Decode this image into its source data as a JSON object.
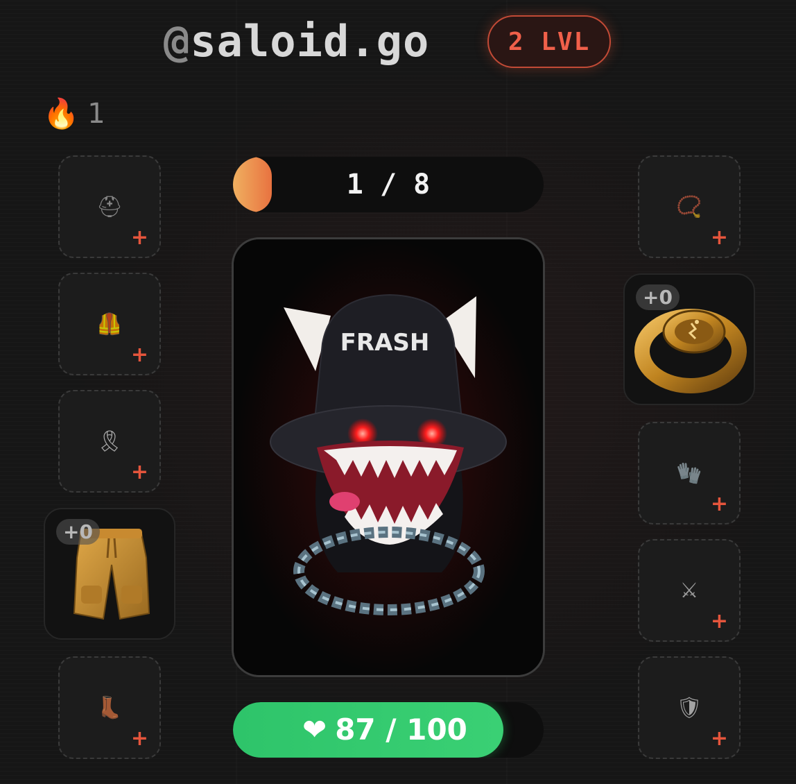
{
  "header": {
    "at": "@",
    "username": "saloid.go",
    "level_label": "2 LVL"
  },
  "streak": {
    "icon": "fire-icon",
    "count": "1"
  },
  "left_slots": [
    {
      "icon": "helmet-icon",
      "glyph": "⛑",
      "plus": "+"
    },
    {
      "icon": "vest-icon",
      "glyph": "🦺",
      "plus": "+"
    },
    {
      "icon": "ribbon-icon",
      "glyph": "🎗",
      "plus": "+"
    },
    {
      "icon": "boot-icon",
      "glyph": "👢",
      "plus": "+"
    }
  ],
  "left_equipped": {
    "item": "pants",
    "badge": "+0"
  },
  "right_slots": [
    {
      "icon": "necklace-icon",
      "glyph": "📿",
      "plus": "+"
    },
    {
      "icon": "gloves-icon",
      "glyph": "🧤",
      "plus": "+"
    },
    {
      "icon": "crossed-swords-icon",
      "glyph": "⚔",
      "plus": "+"
    },
    {
      "icon": "shield-icon",
      "glyph": "🛡",
      "plus": "+"
    }
  ],
  "right_equipped": {
    "item": "ring",
    "badge": "+0"
  },
  "progress": {
    "current": 1,
    "total": 8,
    "label": "1 / 8"
  },
  "character": {
    "hat_text": "FRASH"
  },
  "health": {
    "current": 87,
    "max": 100,
    "label": "87 / 100",
    "icon": "heart-icon"
  },
  "colors": {
    "accent": "#e5553c",
    "health": "#2ec46a",
    "progress": "#e87240"
  }
}
